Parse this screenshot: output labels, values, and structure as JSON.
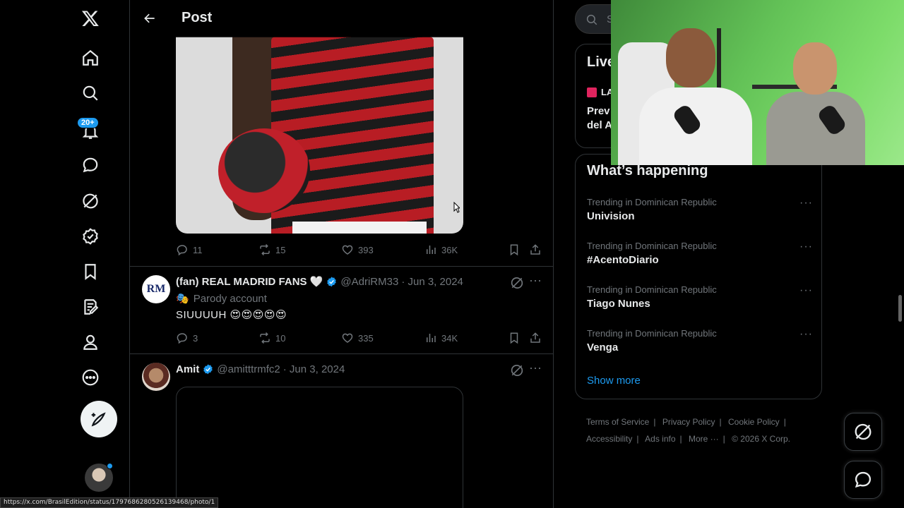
{
  "nav": {
    "notifications_badge": "20+",
    "items": [
      "x-logo",
      "home",
      "search",
      "notifications",
      "messages",
      "grok",
      "verified",
      "bookmarks",
      "articles",
      "profile",
      "more"
    ]
  },
  "header": {
    "title": "Post"
  },
  "tweet1": {
    "replies": "11",
    "reposts": "15",
    "likes": "393",
    "views": "36K"
  },
  "tweet2": {
    "name": "(fan) REAL MADRID FANS 🤍",
    "handle": "@AdriRM33",
    "date": "· Jun 3, 2024",
    "parody": "Parody account",
    "text": "SIUUUUH 😍😍😍😍😍",
    "avatar_text": "RM",
    "replies": "3",
    "reposts": "10",
    "likes": "335",
    "views": "34K"
  },
  "tweet3": {
    "name": "Amit",
    "handle": "@amitttrmfc2",
    "date": "· Jun 3, 2024"
  },
  "right": {
    "search_placeholder": "Se",
    "live_title": "Live",
    "live_tag": "LA",
    "live_line1": "Prev",
    "live_line2": "del A",
    "happening_title": "What’s happening",
    "trends": [
      {
        "context": "Trending in Dominican Republic",
        "topic": "Univision"
      },
      {
        "context": "Trending in Dominican Republic",
        "topic": "#AcentoDiario"
      },
      {
        "context": "Trending in Dominican Republic",
        "topic": "Tiago Nunes"
      },
      {
        "context": "Trending in Dominican Republic",
        "topic": "Venga"
      }
    ],
    "show_more": "Show more",
    "footer": {
      "terms": "Terms of Service",
      "privacy": "Privacy Policy",
      "cookie": "Cookie Policy",
      "accessibility": "Accessibility",
      "ads": "Ads info",
      "more": "More ···",
      "copyright": "© 2026 X Corp."
    }
  },
  "status_url": "https://x.com/BrasilEdition/status/1797686280526139468/photo/1",
  "colors": {
    "accent": "#1d9bf0",
    "background": "#000000",
    "border": "#2f3336",
    "muted": "#71767b"
  }
}
